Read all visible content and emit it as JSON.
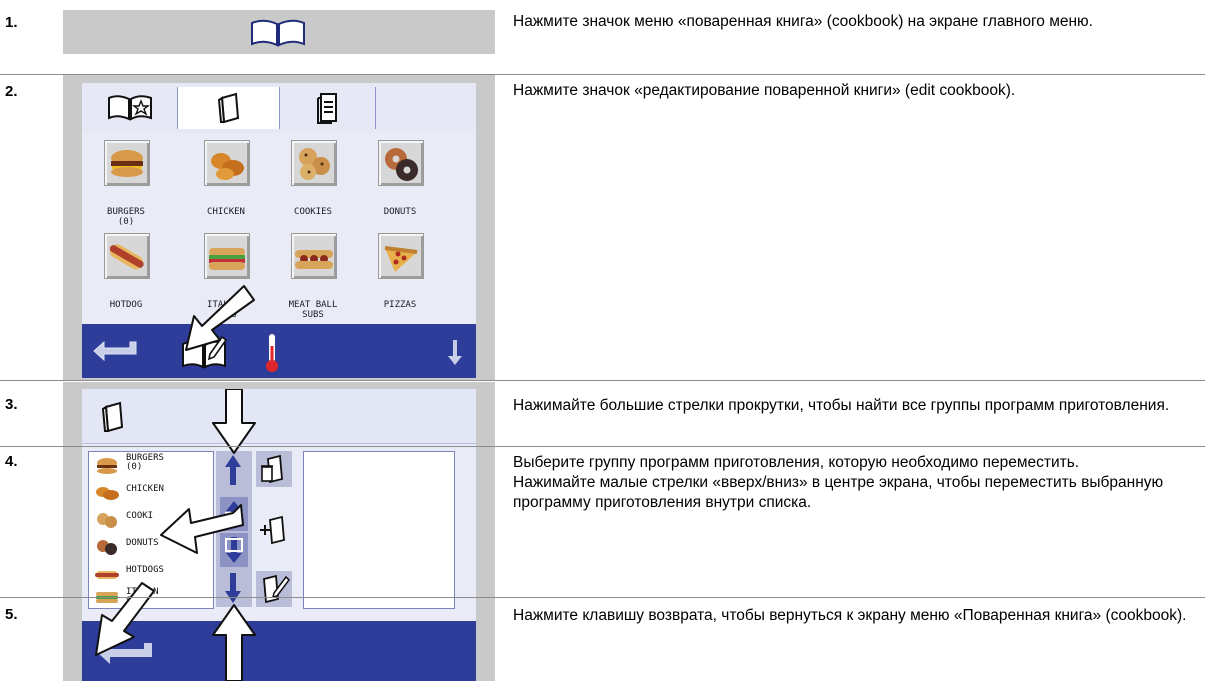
{
  "steps": [
    {
      "num": "1.",
      "text": "Нажмите значок меню «поваренная книга» (cookbook) на экране главного меню."
    },
    {
      "num": "2.",
      "text": "Нажмите значок «редактирование поваренной книги» (edit cookbook)."
    },
    {
      "num": "3.",
      "text": "Нажимайте большие стрелки прокрутки, чтобы найти все группы программ приготовления."
    },
    {
      "num": "4.",
      "text": "Выберите группу программ приготовления, которую необходимо переместить.",
      "text2": "Нажимайте малые стрелки «вверх/вниз» в центре экрана, чтобы переместить выбранную программу приготовления внутри списка."
    },
    {
      "num": "5.",
      "text": "Нажмите клавишу возврата, чтобы вернуться к экрану меню «Поваренная книга» (cookbook)."
    }
  ],
  "screen2": {
    "tiles": [
      {
        "label": "BURGERS",
        "label2": "(0)",
        "icon": "burger-icon"
      },
      {
        "label": "CHICKEN",
        "label2": "",
        "icon": "chicken-icon"
      },
      {
        "label": "COOKIES",
        "label2": "",
        "icon": "cookies-icon"
      },
      {
        "label": "DONUTS",
        "label2": "",
        "icon": "donuts-icon"
      },
      {
        "label": "HOTDOG",
        "label2": "",
        "icon": "hotdog-icon"
      },
      {
        "label": "ITALIAN",
        "label2": "SUBS",
        "icon": "italian-sub-icon"
      },
      {
        "label": "MEAT BALL",
        "label2": "SUBS",
        "icon": "meatball-sub-icon"
      },
      {
        "label": "PIZZAS",
        "label2": "",
        "icon": "pizza-icon"
      }
    ]
  },
  "screen3": {
    "list": [
      {
        "label": "BURGERS",
        "label2": "(0)",
        "icon": "burger-icon"
      },
      {
        "label": "CHICKEN",
        "label2": "",
        "icon": "chicken-icon"
      },
      {
        "label": "COOKI",
        "label2": "",
        "icon": "cookies-icon"
      },
      {
        "label": "DONUTS",
        "label2": "",
        "icon": "donuts-icon"
      },
      {
        "label": "HOTDOGS",
        "label2": "",
        "icon": "hotdog-icon"
      },
      {
        "label": "IT",
        "label2": "S",
        "label3": "N",
        "icon": "italian-sub-icon"
      }
    ]
  },
  "colors": {
    "nav": "#2f3d9a",
    "screen": "#e9ecf6",
    "frame": "#c9c9c9",
    "accent": "#2f3d9a",
    "rule": "#8c8c8c"
  }
}
